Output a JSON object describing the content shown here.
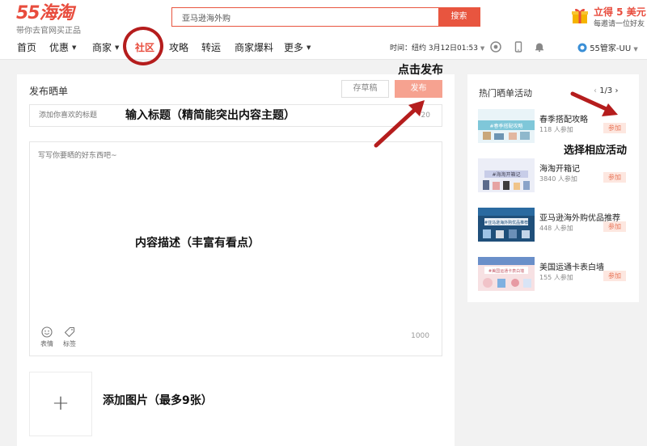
{
  "brand": {
    "name": "55海淘",
    "slogan": "带你去官网买正品"
  },
  "search": {
    "value": "亚马逊海外购",
    "button": "搜索"
  },
  "promo": {
    "title": "立得 5 美元",
    "subtitle": "每邀请一位好友"
  },
  "nav": {
    "items": [
      {
        "label": "首页"
      },
      {
        "label": "优惠"
      },
      {
        "label": "商家"
      },
      {
        "label": "社区"
      },
      {
        "label": "攻略"
      },
      {
        "label": "转运"
      },
      {
        "label": "商家爆料"
      },
      {
        "label": "更多"
      }
    ],
    "time": "时间：纽约 3月12日01:53",
    "user": "55管家-UU"
  },
  "editor": {
    "title": "发布晒单",
    "draft_button": "存草稿",
    "publish_button": "发布",
    "title_placeholder": "添加你喜欢的标题",
    "title_count": "20",
    "content_placeholder": "写写你要晒的好东西吧~",
    "content_count": "1000",
    "tool_emoji": "表情",
    "tool_tag": "标签",
    "add_image": "+"
  },
  "sidebar": {
    "title": "热门晒单活动",
    "pager": "1/3",
    "activities": [
      {
        "name": "春季搭配攻略",
        "count": "118 人参加",
        "join": "参加",
        "thumb_text": "#春季搭配攻略",
        "color": "#7fc7d9"
      },
      {
        "name": "海淘开箱记",
        "count": "3840 人参加",
        "join": "参加",
        "thumb_text": "#海淘开箱记",
        "color": "#c8cde8"
      },
      {
        "name": "亚马逊海外购优品推荐",
        "count": "448 人参加",
        "join": "参加",
        "thumb_text": "#亚马逊海外购优品推荐",
        "color": "#2a5d8a"
      },
      {
        "name": "美国运通卡表白墙",
        "count": "155 人参加",
        "join": "参加",
        "thumb_text": "#美国运通卡表白墙",
        "color": "#f1c3c8"
      }
    ]
  },
  "annotations": {
    "click_publish": "点击发布",
    "enter_title": "输入标题（精简能突出内容主题）",
    "select_activity": "选择相应活动",
    "describe_content": "内容描述（丰富有看点）",
    "add_images": "添加图片（最多9张）"
  },
  "colors": {
    "brand_red": "#e84c3d",
    "publish_disabled": "#f6a290",
    "annotation_red": "#b51d1d"
  }
}
